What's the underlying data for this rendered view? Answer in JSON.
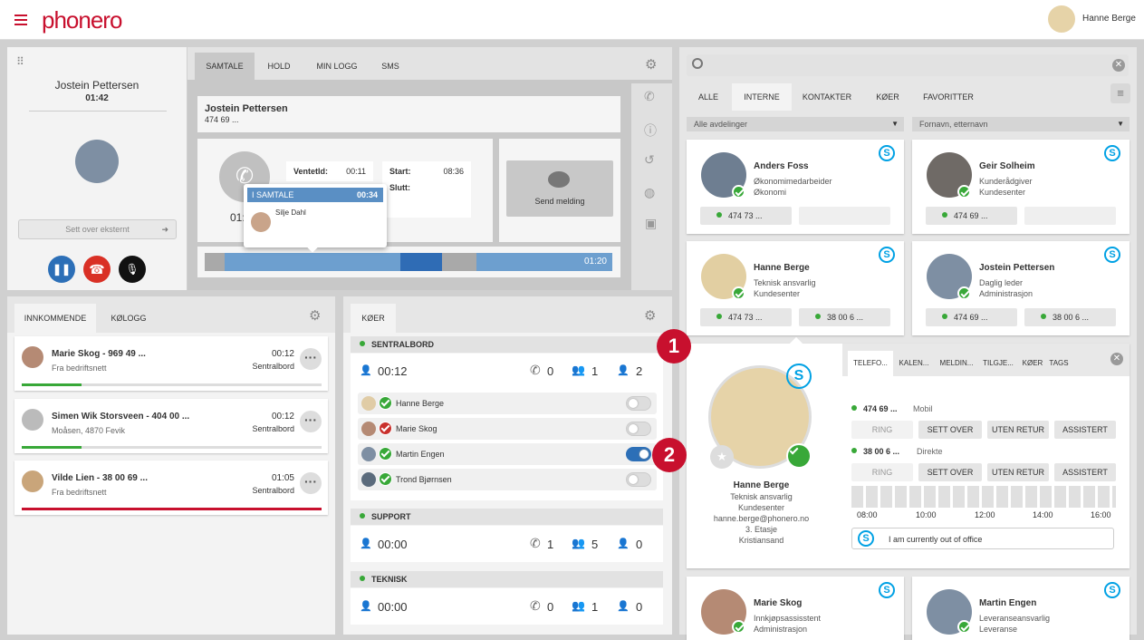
{
  "header": {
    "logo": "phonero",
    "user_name": "Hanne Berge"
  },
  "callpanel": {
    "name": "Jostein Pettersen",
    "duration": "01:42",
    "transfer_placeholder": "Sett over eksternt"
  },
  "calltabs": [
    "SAMTALE",
    "HOLD",
    "MIN LOGG",
    "SMS"
  ],
  "call": {
    "name": "Jostein Pettersen",
    "number": "474 69 ...",
    "venteid_label": "VentetId:",
    "venteid": "00:11",
    "start_label": "Start:",
    "start": "08:36",
    "slutt_label": "Slutt:",
    "timer_partial": "01:",
    "send_sms": "Send melding",
    "timeline_time": "01:20"
  },
  "popup": {
    "title": "I SAMTALE",
    "time": "00:34",
    "name": "Silje Dahl"
  },
  "incoming": {
    "tabs": [
      "INNKOMMENDE",
      "KØLOGG"
    ],
    "items": [
      {
        "title": "Marie Skog - 969 49 ...",
        "sub": "Fra bedriftsnett",
        "time": "00:12",
        "queue": "Sentralbord",
        "bar": "green"
      },
      {
        "title": "Simen Wik Storsveen - 404 00 ...",
        "sub": "Moåsen, 4870 Fevik",
        "time": "00:12",
        "queue": "Sentralbord",
        "bar": "green"
      },
      {
        "title": "Vilde Lien - 38 00 69 ...",
        "sub": "Fra bedriftsnett",
        "time": "01:05",
        "queue": "Sentralbord",
        "bar": "red"
      }
    ]
  },
  "queues": {
    "tab": "KØER",
    "groups": [
      {
        "name": "SENTRALBORD",
        "wait": "00:12",
        "calls": "0",
        "agents": "1",
        "idle": "2"
      },
      {
        "name": "SUPPORT",
        "wait": "00:00",
        "calls": "1",
        "agents": "5",
        "idle": "0"
      },
      {
        "name": "TEKNISK",
        "wait": "00:00",
        "calls": "0",
        "agents": "1",
        "idle": "0"
      }
    ],
    "members": [
      {
        "name": "Hanne Berge",
        "status": "green",
        "on": false
      },
      {
        "name": "Marie Skog",
        "status": "red",
        "on": false
      },
      {
        "name": "Martin Engen",
        "status": "green",
        "on": true
      },
      {
        "name": "Trond Bjørnsen",
        "status": "green",
        "on": false
      }
    ]
  },
  "directory": {
    "tabs": [
      "ALLE",
      "INTERNE",
      "KONTAKTER",
      "KØER",
      "FAVORITTER"
    ],
    "dept_select": "Alle avdelinger",
    "name_select": "Fornavn, etternavn",
    "contacts": [
      {
        "name": "Anders Foss",
        "l1": "Økonomimedarbeider",
        "l2": "Økonomi",
        "n1": "474 73 ...",
        "n2": ""
      },
      {
        "name": "Geir Solheim",
        "l1": "Kunderådgiver",
        "l2": "Kundesenter",
        "n1": "474 69 ...",
        "n2": ""
      },
      {
        "name": "Hanne Berge",
        "l1": "Teknisk ansvarlig",
        "l2": "Kundesenter",
        "n1": "474 73 ...",
        "n2": "38 00 6 ..."
      },
      {
        "name": "Jostein Pettersen",
        "l1": "Daglig leder",
        "l2": "Administrasjon",
        "n1": "474 69 ...",
        "n2": "38 00 6 ..."
      },
      {
        "name": "Marie Skog",
        "l1": "Innkjøpsassisstent",
        "l2": "Administrasjon"
      },
      {
        "name": "Martin Engen",
        "l1": "Leveranseansvarlig",
        "l2": "Leveranse"
      }
    ]
  },
  "detail": {
    "tabs": [
      "TELEFO...",
      "KALEN...",
      "MELDIN...",
      "TILGJE...",
      "KØER",
      "TAGS"
    ],
    "name": "Hanne Berge",
    "title": "Teknisk ansvarlig",
    "dept": "Kundesenter",
    "email": "hanne.berge@phonero.no",
    "floor": "3. Etasje",
    "city": "Kristiansand",
    "phones": [
      {
        "number": "474 69 ...",
        "type": "Mobil"
      },
      {
        "number": "38 00 6 ...",
        "type": "Direkte"
      }
    ],
    "actions": [
      "RING",
      "SETT OVER",
      "UTEN RETUR",
      "ASSISTERT"
    ],
    "hours": [
      "08:00",
      "10:00",
      "12:00",
      "14:00",
      "16:00"
    ],
    "status_msg": "I am currently out of office"
  },
  "markers": [
    "1",
    "2"
  ],
  "colors": {
    "brand": "#c8102e",
    "green": "#38a838",
    "blue": "#2c6fb7"
  }
}
